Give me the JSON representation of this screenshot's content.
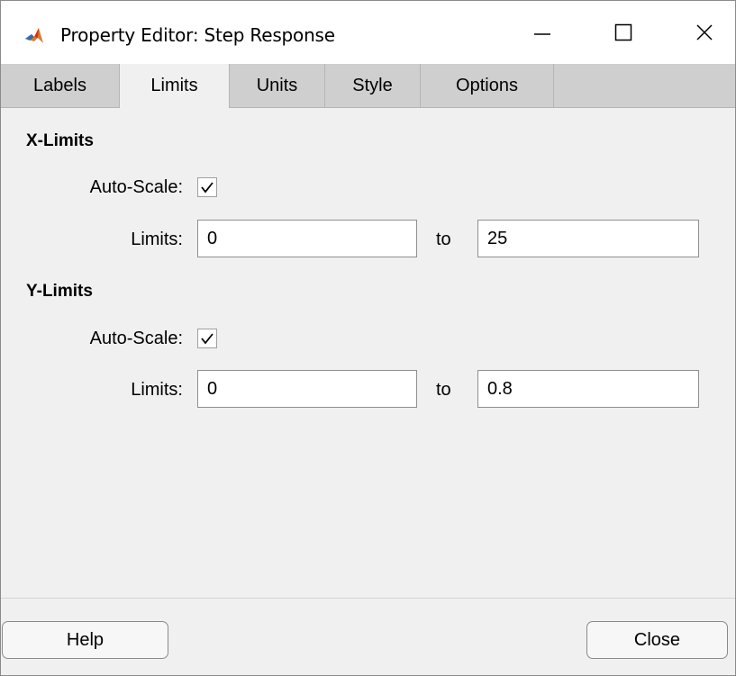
{
  "window": {
    "title": "Property Editor: Step Response",
    "icons": {
      "app": "matlab-logo-icon",
      "minimize": "minimize-icon",
      "maximize": "maximize-icon",
      "close": "close-icon"
    }
  },
  "tabs": [
    {
      "label": "Labels",
      "active": false
    },
    {
      "label": "Limits",
      "active": true
    },
    {
      "label": "Units",
      "active": false
    },
    {
      "label": "Style",
      "active": false
    },
    {
      "label": "Options",
      "active": false
    }
  ],
  "x_limits": {
    "heading": "X-Limits",
    "auto_scale_label": "Auto-Scale:",
    "auto_scale_checked": true,
    "limits_label": "Limits:",
    "min": "0",
    "to_label": "to",
    "max": "25"
  },
  "y_limits": {
    "heading": "Y-Limits",
    "auto_scale_label": "Auto-Scale:",
    "auto_scale_checked": true,
    "limits_label": "Limits:",
    "min": "0",
    "to_label": "to",
    "max": "0.8"
  },
  "buttons": {
    "help": "Help",
    "close": "Close"
  },
  "colors": {
    "titlebar": "#ffffff",
    "tabstrip": "#cfcfcf",
    "panel": "#f0f0f0"
  }
}
